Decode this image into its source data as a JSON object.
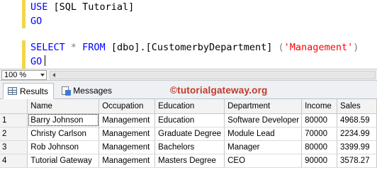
{
  "editor": {
    "line1": {
      "keyword": "USE",
      "rest": " [SQL Tutorial]"
    },
    "line2": {
      "keyword": "GO"
    },
    "line4": {
      "select": "SELECT",
      "star": " * ",
      "from": "FROM",
      "object": " [dbo].[CustomerbyDepartment] ",
      "open": "(",
      "arg": "'Management'",
      "close": ")"
    },
    "line5": {
      "keyword": "GO"
    }
  },
  "zoom": {
    "value": "100 %"
  },
  "tabs": [
    {
      "label": "Results",
      "icon": "grid-icon",
      "active": true
    },
    {
      "label": "Messages",
      "icon": "messages-icon",
      "active": false
    }
  ],
  "watermark": "©tutorialgateway.org",
  "colors": {
    "keyword": "#0000ff",
    "operator": "#808080",
    "string": "#ff0000",
    "watermark": "#c0392b"
  },
  "results": {
    "columns": [
      "Name",
      "Occupation",
      "Education",
      "Department",
      "Income",
      "Sales"
    ],
    "rows": [
      [
        "1",
        "Barry Johnson",
        "Management",
        "Education",
        "Software Developer",
        "80000",
        "4968.59"
      ],
      [
        "2",
        "Christy Carlson",
        "Management",
        "Graduate Degree",
        "Module Lead",
        "70000",
        "2234.99"
      ],
      [
        "3",
        "Rob Johnson",
        "Management",
        "Bachelors",
        "Manager",
        "80000",
        "3399.99"
      ],
      [
        "4",
        "Tutorial Gateway",
        "Management",
        "Masters Degree",
        "CEO",
        "90000",
        "3578.27"
      ]
    ]
  }
}
